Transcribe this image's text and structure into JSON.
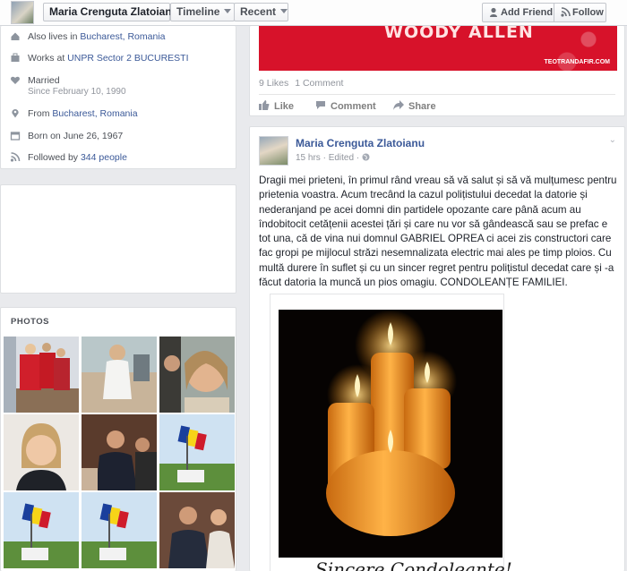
{
  "topbar": {
    "name": "Maria Crenguta Zlatoianu",
    "timeline_label": "Timeline",
    "recent_label": "Recent",
    "add_friend_label": "Add Friend",
    "follow_label": "Follow"
  },
  "intro": {
    "lives": {
      "prefix": "Also lives in ",
      "place": "Bucharest, Romania"
    },
    "works": {
      "prefix": "Works at ",
      "place": "UNPR Sector 2 BUCURESTI"
    },
    "married": {
      "label": "Married",
      "since": "Since February 10, 1990"
    },
    "from": {
      "prefix": "From ",
      "place": "Bucharest, Romania"
    },
    "born": "Born on June 26, 1967",
    "followed": {
      "prefix": "Followed by ",
      "count": "344 people"
    }
  },
  "photos": {
    "title": "PHOTOS"
  },
  "post1": {
    "banner_title": "WOODY ALLEN",
    "banner_site": "TEOTRANDAFIR.COM",
    "likes": "9 Likes",
    "comments": "1 Comment",
    "like_label": "Like",
    "comment_label": "Comment",
    "share_label": "Share"
  },
  "post2": {
    "author": "Maria Crenguta Zlatoianu",
    "time": "15 hrs",
    "edited": "Edited",
    "sep": "·",
    "body": "Dragii mei prieteni, în primul rând vreau să vă salut și să vă mulțumesc pentru prietenia voastra. Acum trecând la cazul polițistului decedat la datorie și nederanjand pe acei domni din partidele opozante care până acum au îndobitocit cetățenii acestei țări și care nu vor să gândească sau se prefac e tot una, că de vina nui domnul GABRIEL OPREA ci acei zis constructori care fac gropi pe mijlocul străzi nesemnalizata electric mai ales pe timp ploios. Cu multă durere în suflet și cu un sincer regret pentru polițistul decedat care și -a făcut datoria la muncă un pios omagiu. CONDOLEANȚE FAMILIEI.",
    "caption": "Sincere Condoleante!"
  },
  "colors": {
    "link": "#3b5998",
    "banner": "#d7122a",
    "page_bg": "#e9eaed"
  }
}
